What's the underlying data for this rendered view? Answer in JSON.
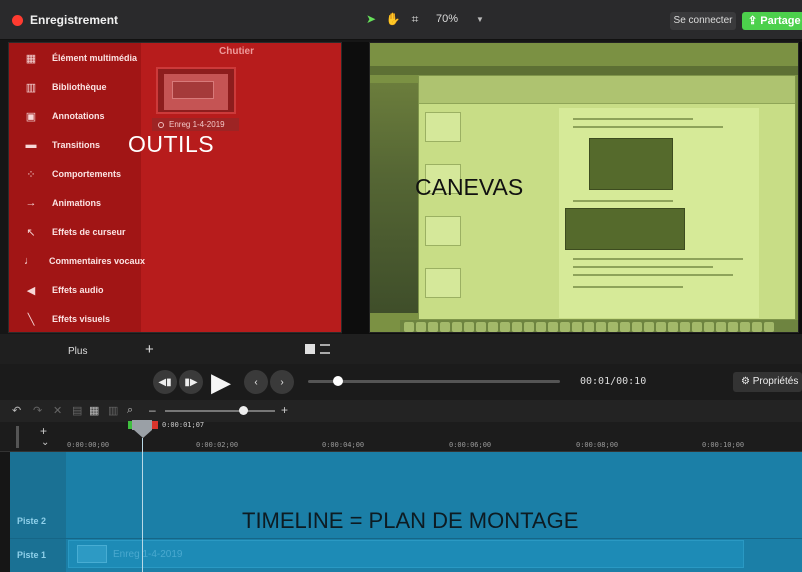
{
  "app": {
    "title": "Enregistrement"
  },
  "toolbar": {
    "icons": [
      "arrow-pointer-icon",
      "hand-pan-icon",
      "crop-icon"
    ],
    "zoom": "70%",
    "connect_label": "Se connecter",
    "share_label": "Partage",
    "colors": {
      "record": "#ff3b30",
      "share": "#4cd04c"
    }
  },
  "tools": {
    "items": [
      {
        "label": "Élément multimédia",
        "icon": "media-icon"
      },
      {
        "label": "Bibliothèque",
        "icon": "library-icon"
      },
      {
        "label": "Annotations",
        "icon": "annotation-icon"
      },
      {
        "label": "Transitions",
        "icon": "transition-icon"
      },
      {
        "label": "Comportements",
        "icon": "behavior-icon"
      },
      {
        "label": "Animations",
        "icon": "animation-icon"
      },
      {
        "label": "Effets de curseur",
        "icon": "cursor-effect-icon"
      },
      {
        "label": "Commentaires vocaux",
        "icon": "microphone-icon"
      },
      {
        "label": "Effets audio",
        "icon": "speaker-icon"
      },
      {
        "label": "Effets visuels",
        "icon": "visual-effect-icon"
      }
    ],
    "more_label": "Plus",
    "bin_title": "Chutier",
    "clip_label": "Enreg 1-4-2019",
    "overlay_label": "OUTILS",
    "overlay_color": "#b71c1c"
  },
  "canvas": {
    "overlay_label": "CANEVAS",
    "overlay_color": "#7b9143"
  },
  "playback": {
    "time": "00:01/00:10",
    "properties_label": "Propriétés",
    "progress": 0.1
  },
  "timeline": {
    "playhead_time": "0:00:01;07",
    "ticks": [
      "0:00:00;00",
      "0:00:02;00",
      "0:00:04;00",
      "0:00:06;00",
      "0:00:08;00",
      "0:00:10;00"
    ],
    "tracks": [
      {
        "label": "Piste 2"
      },
      {
        "label": "Piste 1",
        "clip": "Enreg 1-4-2019"
      }
    ],
    "overlay_label": "TIMELINE = PLAN DE MONTAGE",
    "overlay_color": "#1b7fa7",
    "zoom_level": 0.7
  }
}
